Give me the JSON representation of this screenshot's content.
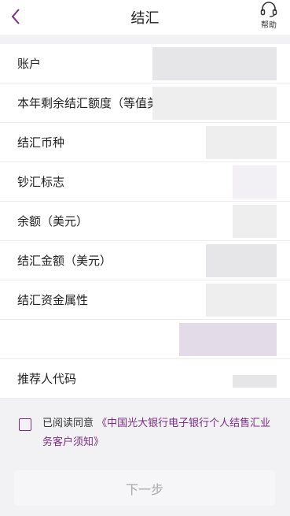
{
  "header": {
    "title": "结汇",
    "back_icon": "chevron-left-icon",
    "help_label": "帮助",
    "help_icon": "headset-icon"
  },
  "rows": [
    {
      "label": "账户"
    },
    {
      "label": "本年剩余结汇额度（等值美"
    },
    {
      "label": "结汇币种"
    },
    {
      "label": "钞汇标志"
    },
    {
      "label": "余额（美元）"
    },
    {
      "label": "结汇金额（美元）"
    },
    {
      "label": "结汇资金属性"
    },
    {
      "label": ""
    },
    {
      "label": "推荐人代码"
    }
  ],
  "agreement": {
    "prefix": "已阅读同意",
    "link": "《中国光大银行电子银行个人结售汇业务客户须知》"
  },
  "next_button": "下一步",
  "colors": {
    "accent": "#7b2c86",
    "background": "#f2f2f4",
    "disabled_text": "#a8a8ad"
  }
}
